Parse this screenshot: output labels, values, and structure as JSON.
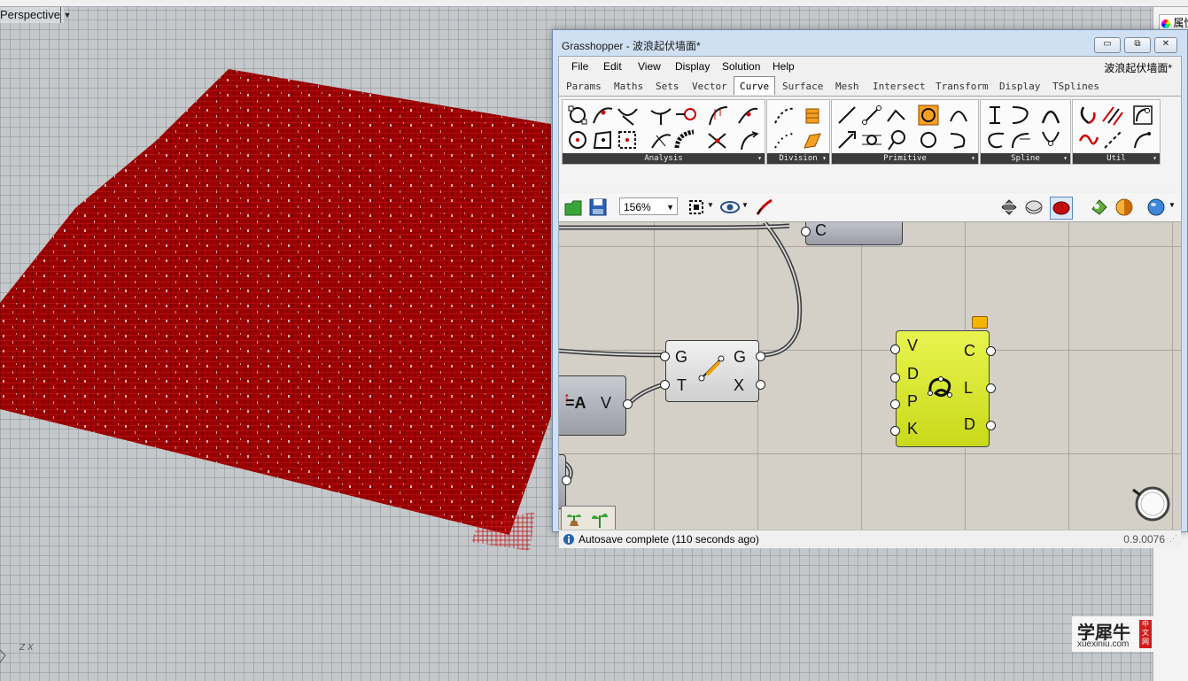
{
  "rhino": {
    "viewport_label": "Perspective",
    "viewport_menu_icon": "chevron-down-icon",
    "axis_label": "Z X",
    "right_panel_tab": "属性",
    "geometry_color": "#9c0000"
  },
  "grasshopper": {
    "title": "Grasshopper - 波浪起伏墙面*",
    "file_name": "波浪起伏墙面*",
    "window_buttons": {
      "minimize": "▭",
      "restore": "⧉",
      "close": "✕"
    },
    "menu": [
      "File",
      "Edit",
      "View",
      "Display",
      "Solution",
      "Help"
    ],
    "tabs": [
      "Params",
      "Maths",
      "Sets",
      "Vector",
      "Curve",
      "Surface",
      "Mesh",
      "Intersect",
      "Transform",
      "Display",
      "TSplines"
    ],
    "active_tab": "Curve",
    "panels": [
      {
        "label": "Analysis"
      },
      {
        "label": "Division"
      },
      {
        "label": "Primitive"
      },
      {
        "label": "Spline"
      },
      {
        "label": "Util"
      }
    ],
    "zoom": "156%",
    "canvas": {
      "component_partial_label": "C",
      "graph_mapper": {
        "inputs": [
          "G",
          "T"
        ],
        "outputs": [
          "G",
          "X"
        ]
      },
      "param_component": {
        "icon_text": "=A",
        "output": "V"
      },
      "curve_component": {
        "inputs": [
          "V",
          "D",
          "P",
          "K"
        ],
        "outputs": [
          "C",
          "L",
          "D"
        ]
      },
      "canvas_color": "#d4d0c8",
      "component_accent": "#d4e22a"
    },
    "status": "Autosave complete (110 seconds ago)",
    "version": "0.9.0076"
  },
  "watermark": {
    "main": "学犀牛",
    "sub": "xuexiniu.com",
    "seal": "中文网"
  }
}
